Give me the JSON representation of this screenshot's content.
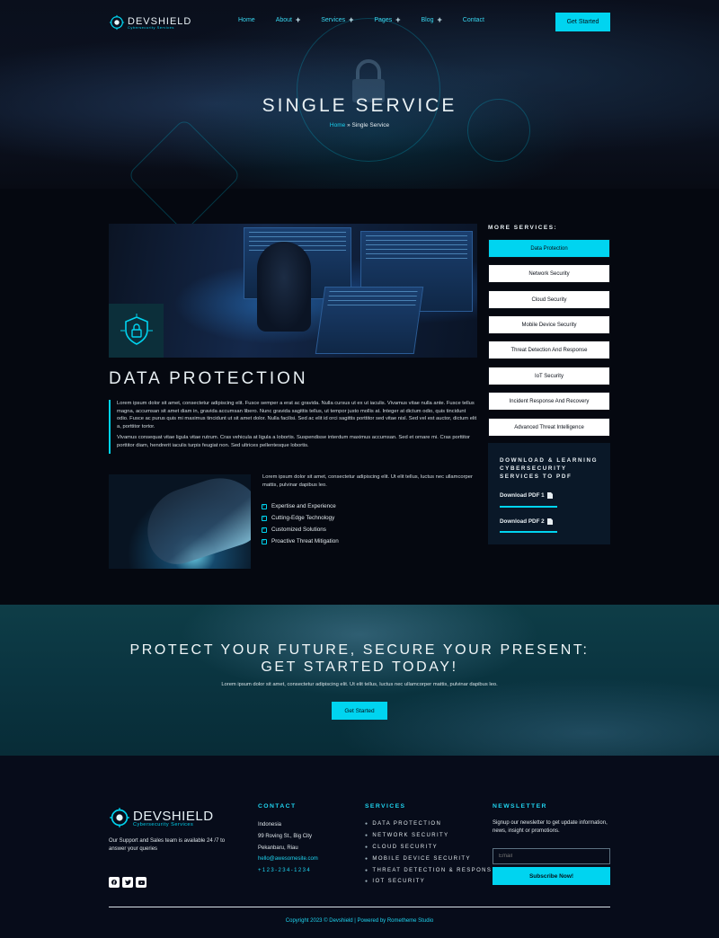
{
  "brand": {
    "name": "DEVSHIELD",
    "tagline": "Cybersecurity Services"
  },
  "nav": {
    "items": [
      {
        "label": "Home"
      },
      {
        "label": "About"
      },
      {
        "label": "Services"
      },
      {
        "label": "Pages"
      },
      {
        "label": "Blog"
      },
      {
        "label": "Contact"
      }
    ],
    "cta_label": "Get Started"
  },
  "hero": {
    "title": "SINGLE SERVICE",
    "breadcrumb_home": "Home",
    "breadcrumb_sep": "»",
    "breadcrumb_current": "Single Service"
  },
  "main": {
    "title": "DATA PROTECTION",
    "paragraph_1": "Lorem ipsum dolor sit amet, consectetur adipiscing elit. Fusce semper a erat ac gravida. Nulla cursus ut ex ut iaculis. Vivamus vitae nulla ante. Fusce tellus magna, accumsan sit amet diam in, gravida accumsan libero. Nunc gravida sagittis tellus, ut tempor justo mollis at. Integer at dictum odio, quis tincidunt odio. Fusce ac purus quis mi maximus tincidunt ut sit amet dolor. Nulla facilisi. Sed ac elit id orci sagittis porttitor sed vitae nisl. Sed vel est auctor, dictum elit a, porttitor tortor.",
    "paragraph_2": "Vivamus consequat vitae ligula vitae rutrum. Cras vehicula at ligula a lobortis. Suspendisse interdum maximus accumsan. Sed et ornare mi. Cras porttitor porttitor diam, hendrerit iaculis turpis feugiat non. Sed ultrices pellentesque lobortis.",
    "side_text": "Lorem ipsum dolor sit amet, consectetur adipiscing elit. Ut elit tellus, luctus nec ullamcorper mattis, pulvinar dapibus leo.",
    "features": [
      {
        "label": "Expertise and Experience"
      },
      {
        "label": "Cutting-Edge Technology"
      },
      {
        "label": "Customized Solutions"
      },
      {
        "label": "Proactive Threat Mitigation"
      }
    ]
  },
  "sidebar": {
    "title": "MORE SERVICES:",
    "services": [
      {
        "label": "Data Protection"
      },
      {
        "label": "Network Security"
      },
      {
        "label": "Cloud Security"
      },
      {
        "label": "Mobile Device Security"
      },
      {
        "label": "Threat Detection And Response"
      },
      {
        "label": "IoT Security"
      },
      {
        "label": "Incident Response And Recovery"
      },
      {
        "label": "Advanced Threat Intelligence"
      }
    ],
    "download_title": "DOWNLOAD & LEARNING CYBERSECURITY SERVICES TO PDF",
    "pdf_1": "Download PDF 1",
    "pdf_2": "Download PDF 2"
  },
  "cta": {
    "title_line_1": "PROTECT YOUR FUTURE, SECURE YOUR PRESENT:",
    "title_line_2": "GET STARTED TODAY!",
    "subtitle": "Lorem ipsum dolor sit amet, consectetur adipiscing elit. Ut elit tellus, luctus nec ullamcorper mattis, pulvinar dapibus leo.",
    "button": "Get Started"
  },
  "footer": {
    "about": "Our Support and Sales team is available 24 /7 to answer your queries",
    "contact_title": "CONTACT",
    "contact_country": "Indonesia",
    "contact_street": "99 Roving St., Big City",
    "contact_city": "Pekanbaru, Riau",
    "contact_email": "hello@awesomesite.com",
    "contact_phone": "+123-234-1234",
    "services_title": "SERVICES",
    "services": [
      {
        "label": "DATA PROTECTION"
      },
      {
        "label": "NETWORK SECURITY"
      },
      {
        "label": "CLOUD SECURITY"
      },
      {
        "label": "MOBILE DEVICE SECURITY"
      },
      {
        "label": "THREAT DETECTION & RESPONS"
      },
      {
        "label": "IOT SECURITY"
      }
    ],
    "newsletter_title": "NEWSLETTER",
    "newsletter_text": "Signup our newsletter to get update information, news, insight or promotions.",
    "email_placeholder": "Email",
    "subscribe": "Subscribe Now!",
    "copyright": "Copyright 2023 © Devshield | Powered by Rometheme Studio",
    "socials": [
      {
        "icon": "facebook-icon"
      },
      {
        "icon": "twitter-icon"
      },
      {
        "icon": "youtube-icon"
      }
    ]
  },
  "colors": {
    "accent": "#00d4f0",
    "background": "#050810",
    "cta_band": "#0a3440"
  }
}
